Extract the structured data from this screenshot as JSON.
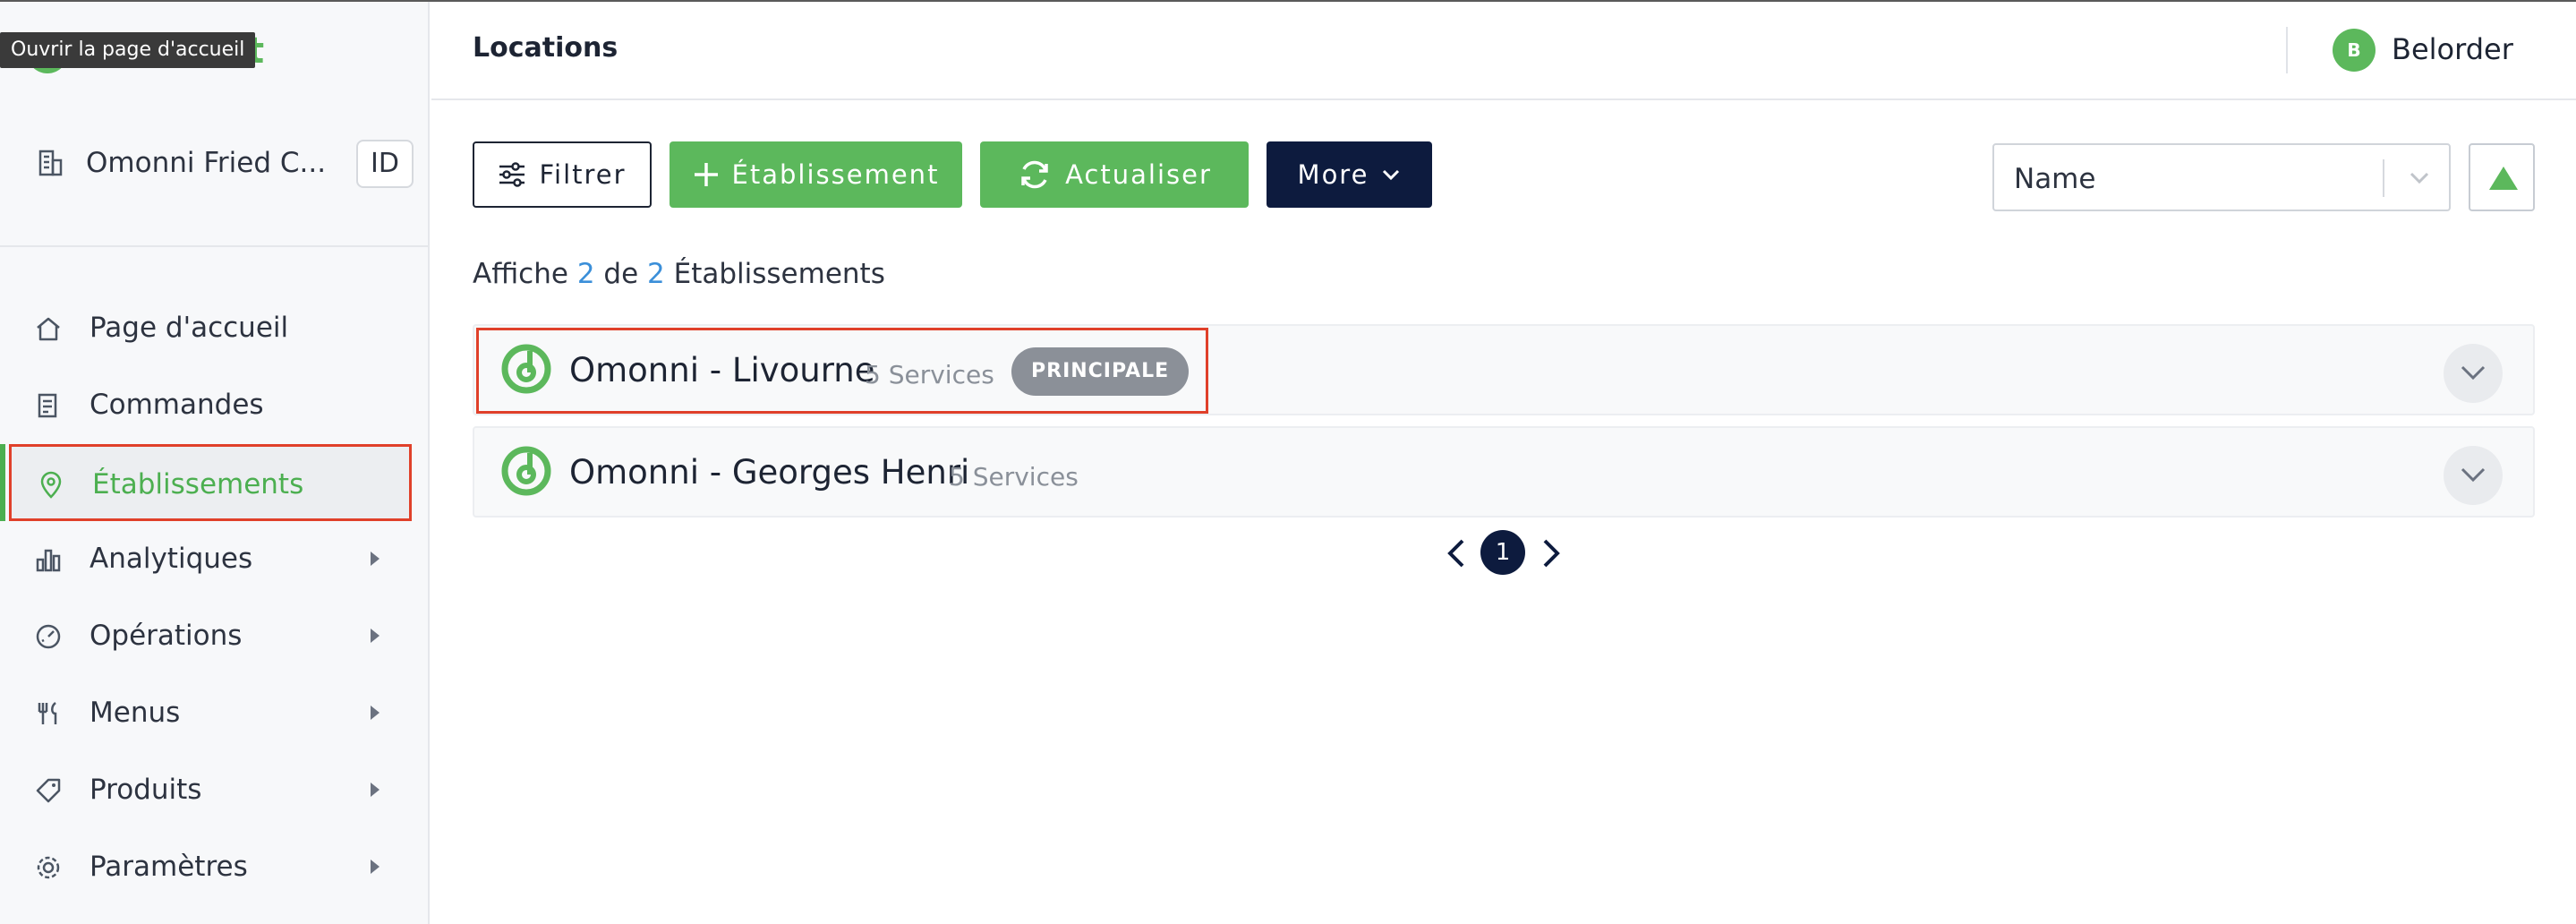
{
  "tooltip": "Ouvrir la page d'accueil",
  "brand": {
    "trailing_letter": "t"
  },
  "org": {
    "name": "Omonni Fried C...",
    "id_label": "ID"
  },
  "sidebar": {
    "items": [
      {
        "label": "Page d'accueil",
        "icon": "home-icon"
      },
      {
        "label": "Commandes",
        "icon": "orders-icon"
      },
      {
        "label": "Établissements",
        "icon": "location-pin-icon",
        "active": true
      },
      {
        "label": "Analytiques",
        "icon": "bar-chart-icon"
      },
      {
        "label": "Opérations",
        "icon": "gauge-icon"
      },
      {
        "label": "Menus",
        "icon": "utensils-icon"
      },
      {
        "label": "Produits",
        "icon": "tag-icon"
      },
      {
        "label": "Paramètres",
        "icon": "gear-icon"
      }
    ]
  },
  "header": {
    "title": "Locations",
    "user_initial": "B",
    "user_name": "Belorder"
  },
  "toolbar": {
    "filter_label": "Filtrer",
    "add_label": "Établissement",
    "refresh_label": "Actualiser",
    "more_label": "More",
    "sort_field": "Name"
  },
  "summary": {
    "prefix": "Affiche",
    "shown": "2",
    "middle": "de",
    "total": "2",
    "suffix": "Établissements"
  },
  "locations": [
    {
      "name": "Omonni - Livourne",
      "services": "5 Services",
      "badge": "PRINCIPALE"
    },
    {
      "name": "Omonni - Georges Henri",
      "services": "5 Services"
    }
  ],
  "pagination": {
    "current_page": "1"
  },
  "colors": {
    "brand_green": "#5cb85c",
    "navy": "#0d1b3e",
    "highlight_red": "#e0402a",
    "link_blue": "#3b8fd9"
  }
}
